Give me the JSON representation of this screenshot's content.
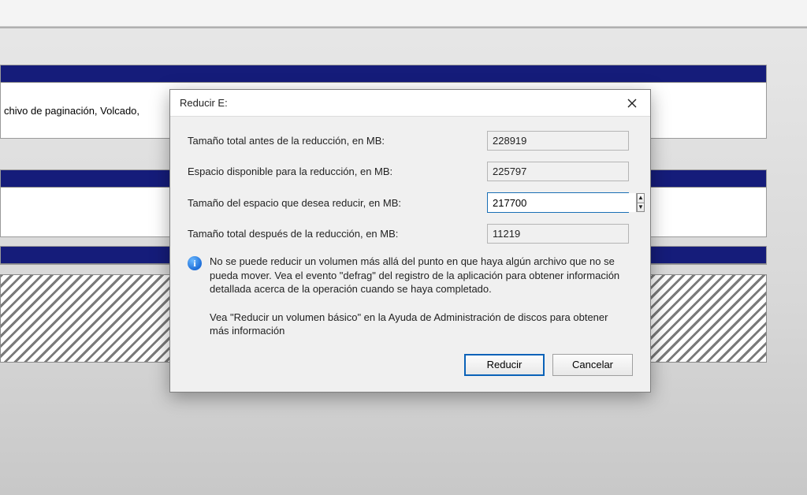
{
  "background": {
    "partition_text": "chivo de paginación, Volcado,"
  },
  "dialog": {
    "title": "Reducir E:",
    "rows": {
      "total_before": {
        "label": "Tamaño total antes de la reducción, en MB:",
        "value": "228919"
      },
      "available": {
        "label": "Espacio disponible para la reducción, en MB:",
        "value": "225797"
      },
      "to_shrink": {
        "label": "Tamaño del espacio que desea reducir, en MB:",
        "value": "217700"
      },
      "total_after": {
        "label": "Tamaño total después de la reducción, en MB:",
        "value": "11219"
      }
    },
    "info_text": "No se puede reducir un volumen más allá del punto en que haya algún archivo que no se pueda mover. Vea el evento \"defrag\" del registro de la aplicación para obtener información detallada acerca de la operación cuando se haya completado.",
    "help_text": "Vea \"Reducir un volumen básico\"  en la Ayuda de Administración de discos para obtener más información",
    "buttons": {
      "shrink": "Reducir",
      "cancel": "Cancelar"
    }
  }
}
